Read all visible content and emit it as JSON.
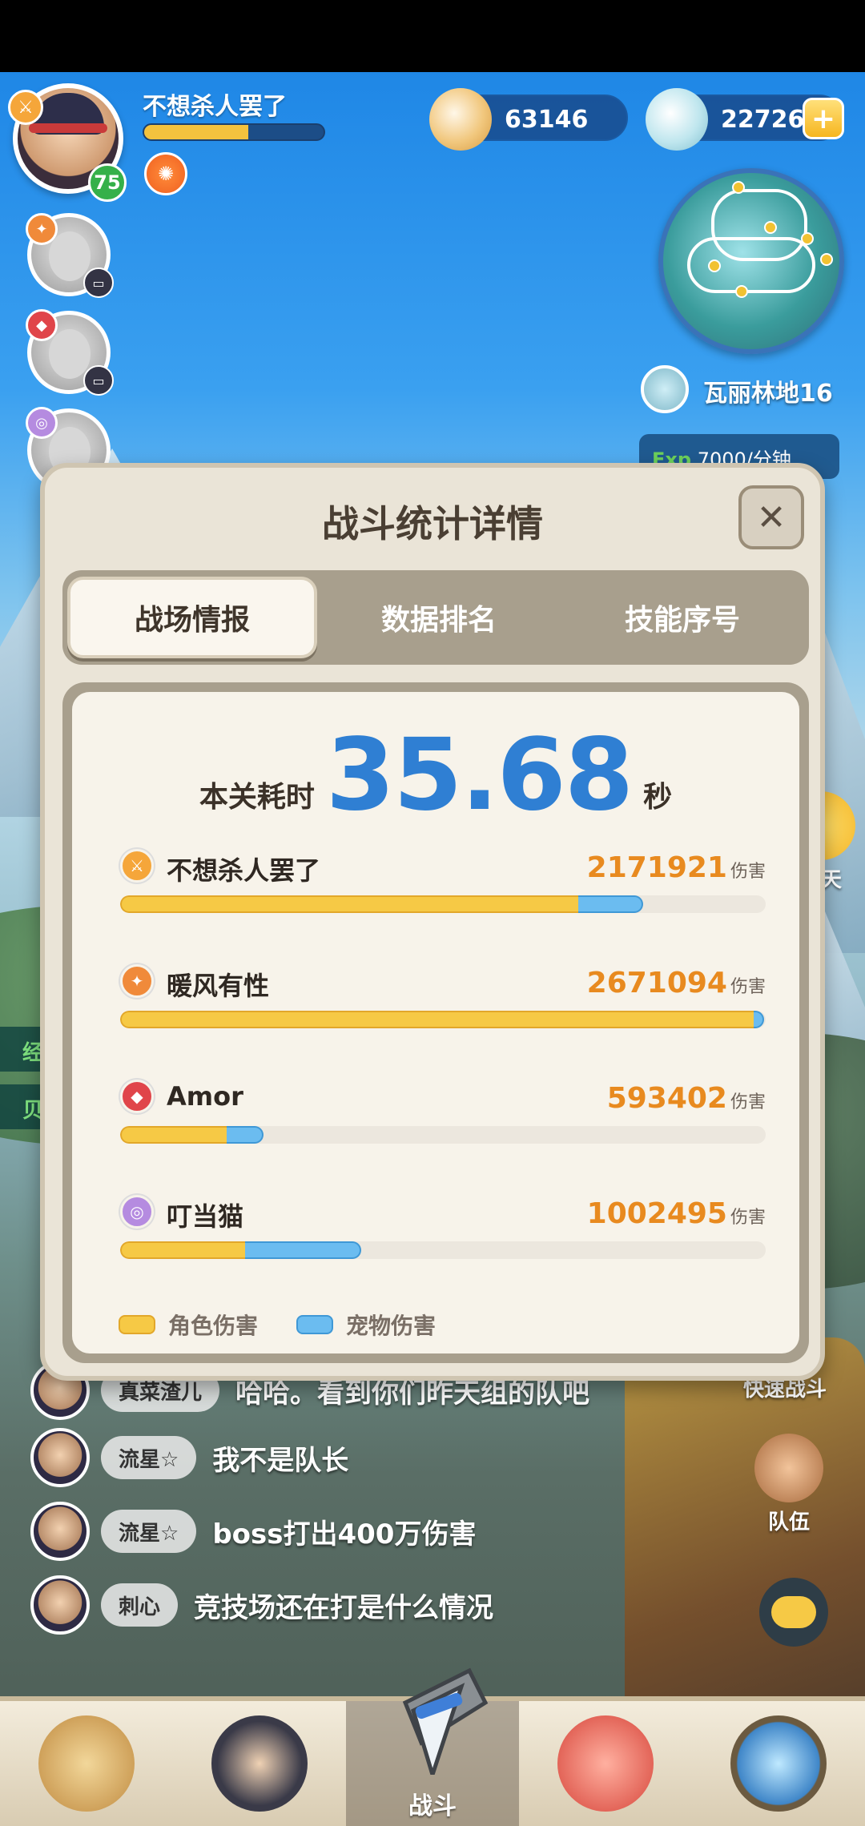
{
  "player": {
    "name": "不想杀人罢了",
    "level": "75",
    "exp_progress": 0.58,
    "class_icon": "crossed-swords-icon"
  },
  "currencies": {
    "shells": "63146",
    "pearls": "22726"
  },
  "map": {
    "location": "瓦丽林地16",
    "exp_rate_tag": "Exp",
    "exp_rate": "7000/分钟"
  },
  "side_labels": [
    "经",
    "贝"
  ],
  "modal": {
    "title": "战斗统计详情",
    "close_icon": "close-icon",
    "tabs": [
      {
        "label": "战场情报",
        "active": true
      },
      {
        "label": "数据排名",
        "active": false
      },
      {
        "label": "技能序号",
        "active": false
      }
    ],
    "time_label": "本关耗时",
    "time_value": "35.68",
    "time_unit": "秒",
    "damage_unit": "伤害",
    "players": [
      {
        "name": "不想杀人罢了",
        "damage": "2171921",
        "class_color": "#f5a63a",
        "class_icon": "crossed-swords-icon",
        "char_share": 0.71,
        "pet_share": 0.1
      },
      {
        "name": "暖风有性",
        "damage": "2671094",
        "class_color": "#f08a3a",
        "class_icon": "flame-icon",
        "char_share": 0.982,
        "pet_share": 0.015
      },
      {
        "name": "Amor",
        "damage": "593402",
        "class_color": "#e0454a",
        "class_icon": "fish-icon",
        "char_share": 0.165,
        "pet_share": 0.057
      },
      {
        "name": "叮当猫",
        "damage": "1002495",
        "class_color": "#b58be0",
        "class_icon": "swirl-icon",
        "char_share": 0.193,
        "pet_share": 0.18
      }
    ],
    "legend": {
      "char_label": "角色伤害",
      "pet_label": "宠物伤害",
      "char_color": "#f6c945",
      "pet_color": "#6bbcf0"
    }
  },
  "chat": [
    {
      "tag": "真菜渣儿",
      "message": "哈哈。看到你们昨天组的队吧"
    },
    {
      "tag": "流星☆",
      "message": "我不是队长"
    },
    {
      "tag": "流星☆",
      "message": "boss打出400万伤害"
    },
    {
      "tag": "刺心",
      "message": "竞技场还在打是什么情况"
    }
  ],
  "side_buttons": {
    "chat": "聊天",
    "quick_battle": "快速战斗",
    "team": "队伍"
  },
  "bottom_nav": {
    "active_label": "战斗"
  }
}
